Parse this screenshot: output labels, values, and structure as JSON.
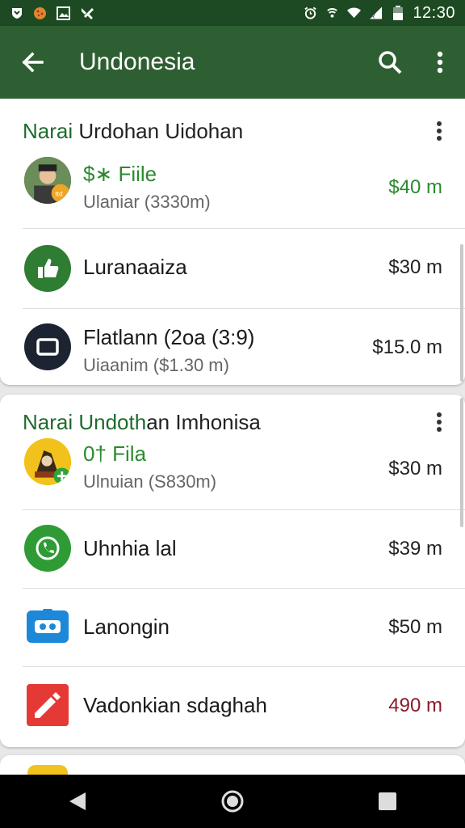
{
  "status_bar": {
    "time": "12:30",
    "left_icons": [
      "shield-icon",
      "pizza-icon",
      "image-icon",
      "tools-icon"
    ],
    "right_icons": [
      "alarm-icon",
      "wifi-call-icon",
      "wifi-icon",
      "signal-icon",
      "battery-icon"
    ]
  },
  "appbar": {
    "title": "Undonesia",
    "color": "#2e5f32"
  },
  "card1": {
    "title_prefix": "Narai",
    "title_rest": " Urdohan Uidohan",
    "rows": [
      {
        "icon": "avatar-photo-icon",
        "name": "$∗ Fiile",
        "sub": "Ulaniar (3330m)",
        "amount": "$40 m"
      },
      {
        "icon": "thumbs-up-icon",
        "name": "Luranaaiza",
        "amount": "$30 m"
      },
      {
        "icon": "square-icon",
        "name": "Flatlann (2oa (3:9)",
        "sub": "Uiaanim ($1.30 m)",
        "amount": "$15.0 m"
      }
    ]
  },
  "card2": {
    "title_prefix": "Narai Undoth",
    "title_rest": "an Imhonisa",
    "rows": [
      {
        "icon": "avatar-cartoon-icon",
        "name": "0† Fila",
        "sub": "Ulnuian (S830m)",
        "amount": "$30 m"
      },
      {
        "icon": "phone-icon",
        "name": "Uhnhia lal",
        "amount": "$39 m"
      },
      {
        "icon": "game-icon",
        "name": "Lanongin",
        "amount": "$50 m"
      },
      {
        "icon": "edit-icon",
        "name": "Vadonkian sdaghah",
        "amount": "490 m"
      }
    ]
  },
  "colors": {
    "green_text": "#2c8a2f",
    "red_text": "#8b1a2b"
  }
}
